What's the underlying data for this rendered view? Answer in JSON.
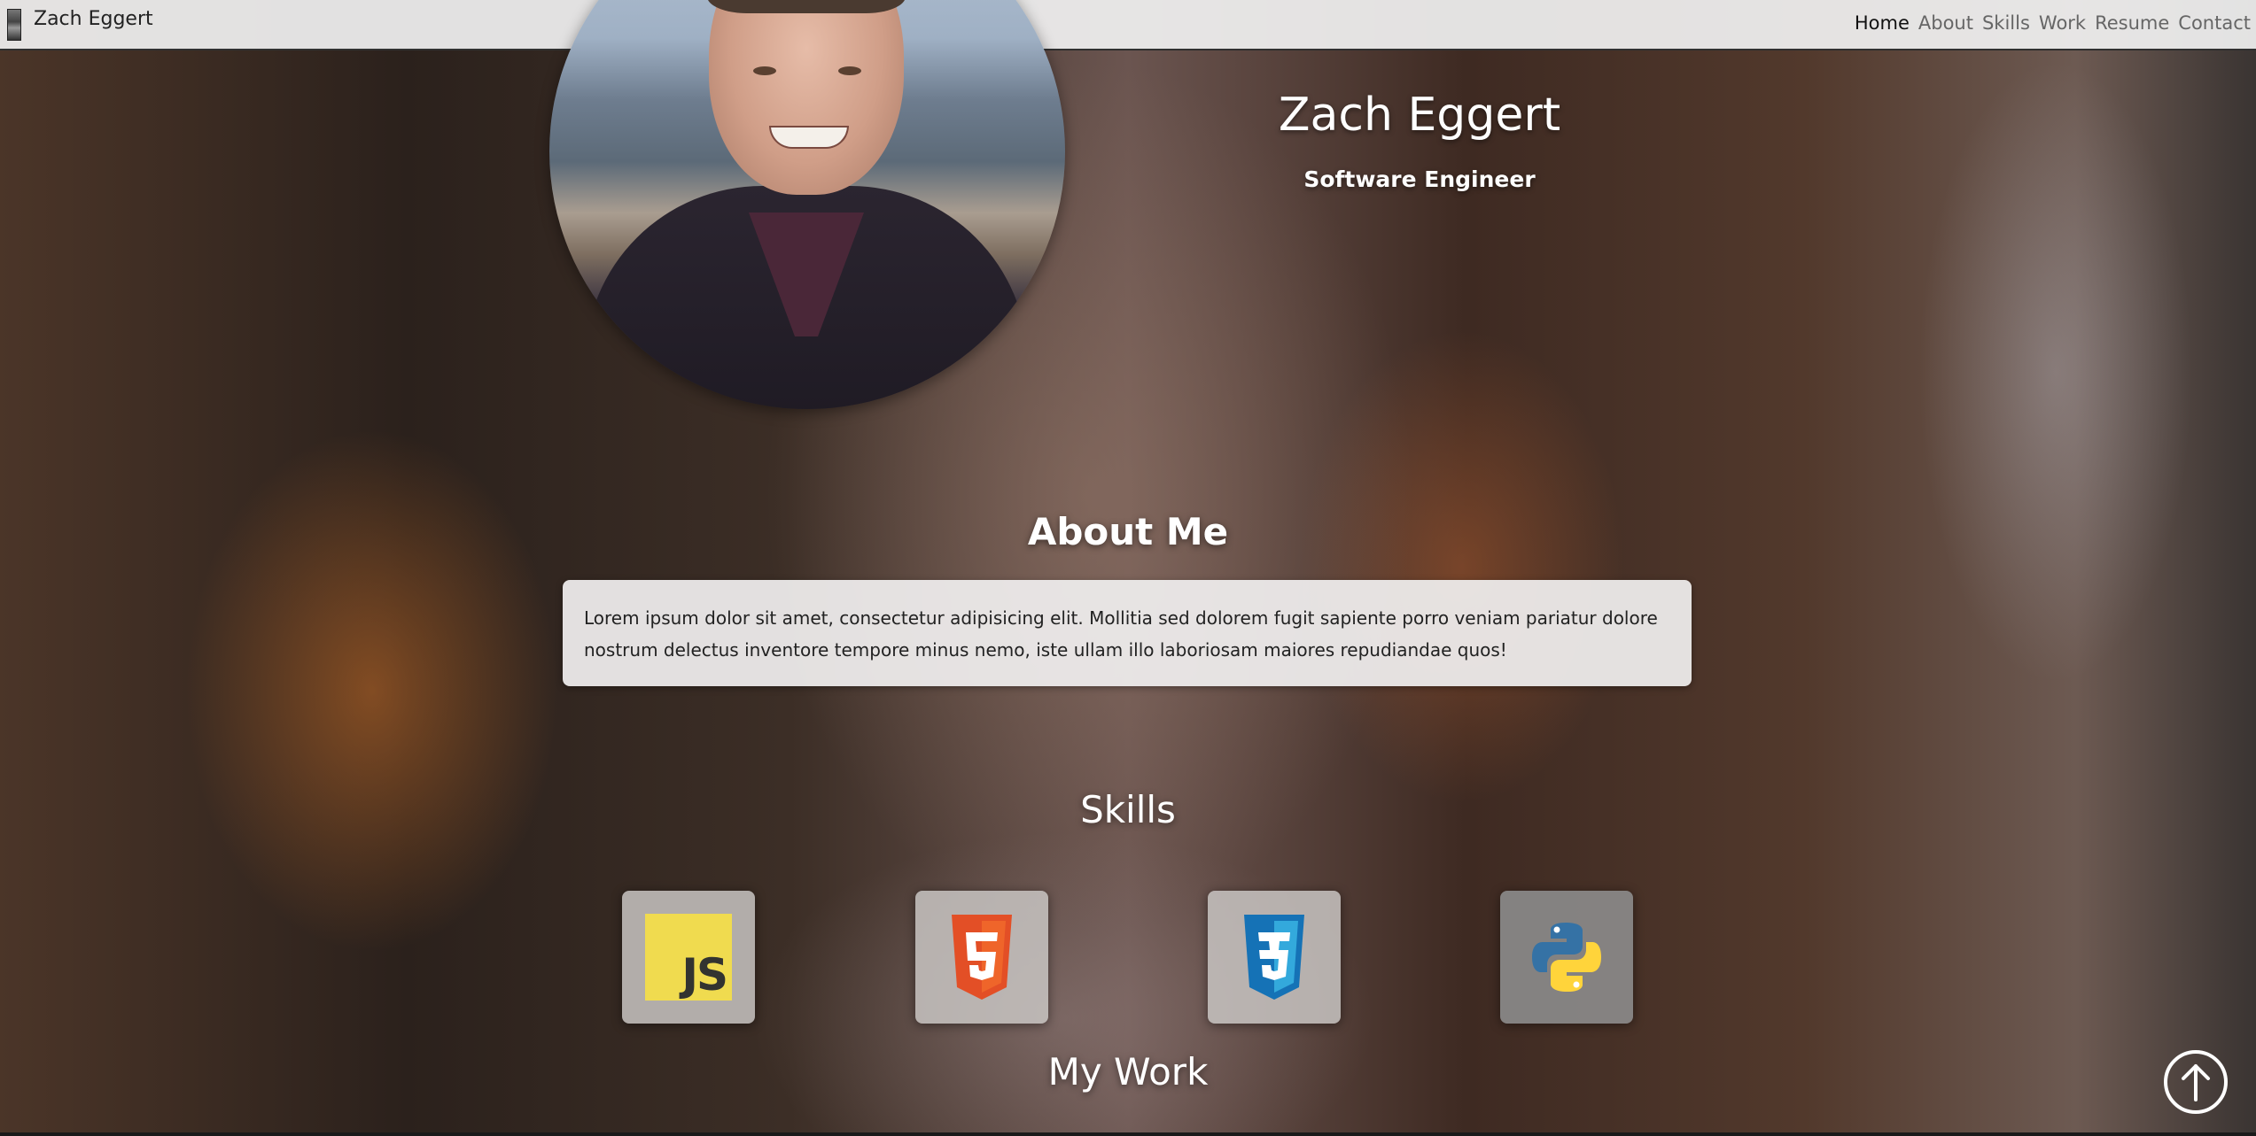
{
  "nav": {
    "brand": "Zach Eggert",
    "links": [
      "Home",
      "About",
      "Skills",
      "Work",
      "Resume",
      "Contact"
    ],
    "active": "Home"
  },
  "header": {
    "name": "Zach Eggert",
    "subtitle": "Software Engineer"
  },
  "about": {
    "title": "About Me",
    "text": "Lorem ipsum dolor sit amet, consectetur adipisicing elit. Mollitia sed dolorem fugit sapiente porro veniam pariatur dolore nostrum delectus inventore tempore minus nemo, iste ullam illo laboriosam maiores repudiandae quos!"
  },
  "skills": {
    "title": "Skills",
    "items": [
      {
        "icon": "javascript-icon",
        "logo_text": "JS",
        "color": "#f0db4f"
      },
      {
        "icon": "html5-icon",
        "color": "#e34f26"
      },
      {
        "icon": "css3-icon",
        "color": "#1572b6"
      },
      {
        "icon": "python-icon",
        "colors": [
          "#3572a5",
          "#ffd43b"
        ]
      }
    ]
  },
  "work": {
    "title": "My Work"
  },
  "scroll_top": {
    "icon": "arrow-up-icon"
  }
}
